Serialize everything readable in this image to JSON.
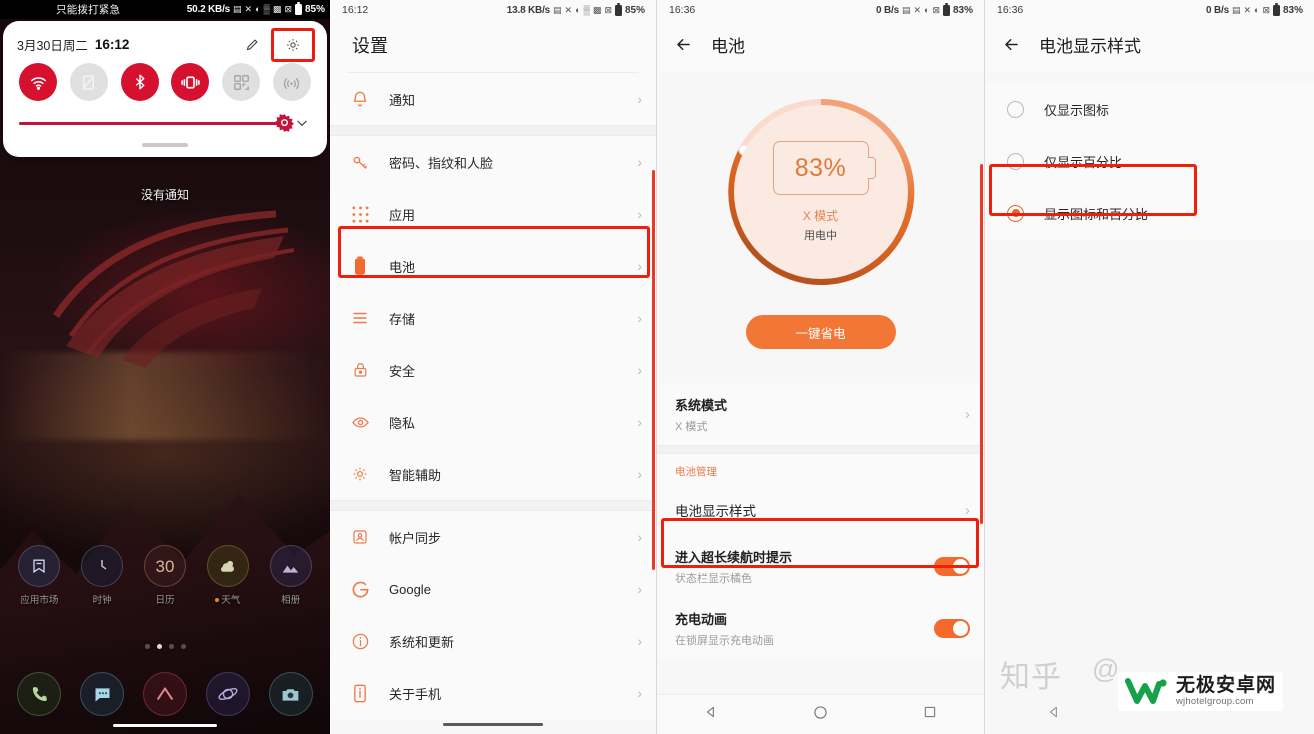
{
  "panel1": {
    "statusbar": {
      "emergency": "只能拨打紧急",
      "speed": "50.2 KB/s",
      "battery_pct": "85%",
      "icons": [
        "screenshot-icon",
        "no-sim-icon",
        "dnd-icon",
        "wifi-icon",
        "signal-icon",
        "mute-icon",
        "battery-icon"
      ]
    },
    "quick_settings": {
      "date": "3月30日周二",
      "time": "16:12",
      "edit_icon": "pencil-icon",
      "settings_icon": "gear-icon",
      "toggles": [
        {
          "name": "wifi-toggle",
          "state": "on"
        },
        {
          "name": "mobile-data-toggle",
          "state": "off"
        },
        {
          "name": "bluetooth-toggle",
          "state": "on"
        },
        {
          "name": "vibrate-toggle",
          "state": "on"
        },
        {
          "name": "qr-scan-toggle",
          "state": "off"
        },
        {
          "name": "hotspot-toggle",
          "state": "off"
        }
      ],
      "brightness_value": 97
    },
    "notification_text": "没有通知",
    "apps": [
      {
        "label": "应用市场",
        "icon": "app-store-icon"
      },
      {
        "label": "时钟",
        "icon": "clock-icon"
      },
      {
        "label": "日历",
        "icon": "calendar-icon",
        "day": "30"
      },
      {
        "label": "天气",
        "icon": "weather-icon"
      },
      {
        "label": "相册",
        "icon": "gallery-icon"
      }
    ],
    "dock": [
      {
        "name": "phone-icon"
      },
      {
        "name": "messages-icon"
      },
      {
        "name": "armoury-crate-icon"
      },
      {
        "name": "browser-icon"
      },
      {
        "name": "camera-icon"
      }
    ],
    "page_dots": 4,
    "active_dot": 2
  },
  "panel2": {
    "statusbar": {
      "time": "16:12",
      "speed": "13.8 KB/s",
      "battery_pct": "85%"
    },
    "title": "设置",
    "items": [
      {
        "label": "通知",
        "icon": "bell-icon"
      },
      {
        "label": "密码、指纹和人脸",
        "icon": "key-icon"
      },
      {
        "label": "应用",
        "icon": "apps-grid-icon"
      },
      {
        "label": "电池",
        "icon": "battery-icon",
        "highlighted": true
      },
      {
        "label": "存储",
        "icon": "storage-icon"
      },
      {
        "label": "安全",
        "icon": "lock-icon"
      },
      {
        "label": "隐私",
        "icon": "privacy-eye-icon"
      },
      {
        "label": "智能辅助",
        "icon": "smart-assist-icon"
      },
      {
        "label": "帐户同步",
        "icon": "account-sync-icon"
      },
      {
        "label": "Google",
        "icon": "google-icon"
      },
      {
        "label": "系统和更新",
        "icon": "info-circle-icon"
      },
      {
        "label": "关于手机",
        "icon": "about-phone-icon"
      }
    ]
  },
  "panel3": {
    "statusbar": {
      "time": "16:36",
      "speed": "0 B/s",
      "battery_pct": "83%"
    },
    "title": "电池",
    "back_icon": "back-arrow-icon",
    "ring": {
      "percent_label": "83%",
      "percent_value": 83,
      "mode_title": "X 模式",
      "mode_sub": "用电中",
      "track_color": "#fadcce",
      "progress_from": "#f6b392",
      "progress_to": "#bb5a2a"
    },
    "saver_button": "一键省电",
    "system_mode": {
      "title": "系统模式",
      "value": "X 模式"
    },
    "section_header": "电池管理",
    "display_style_row": {
      "label": "电池显示样式",
      "highlighted": true
    },
    "switches": [
      {
        "title": "进入超长续航时提示",
        "sub": "状态栏显示橘色",
        "state": "on"
      },
      {
        "title": "充电动画",
        "sub": "在锁屏显示充电动画",
        "state": "on"
      }
    ],
    "nav": [
      "back-triangle-icon",
      "home-circle-icon",
      "recents-square-icon"
    ]
  },
  "panel4": {
    "statusbar": {
      "time": "16:36",
      "speed": "0 B/s",
      "battery_pct": "83%"
    },
    "title": "电池显示样式",
    "back_icon": "back-arrow-icon",
    "options": [
      {
        "label": "仅显示图标",
        "selected": false
      },
      {
        "label": "仅显示百分比",
        "selected": false
      },
      {
        "label": "显示图标和百分比",
        "selected": true,
        "highlighted": true
      }
    ],
    "nav": [
      "back-triangle-icon"
    ]
  },
  "watermarks": {
    "zhihu": "知乎",
    "at": "@",
    "brand_cn": "无极安卓网",
    "brand_url": "wjhotelgroup.com"
  },
  "colors": {
    "accent_orange": "#f27636",
    "highlight_red": "#f01f0c",
    "toggle_red": "#d6112f",
    "slider_red": "#c4143c"
  }
}
